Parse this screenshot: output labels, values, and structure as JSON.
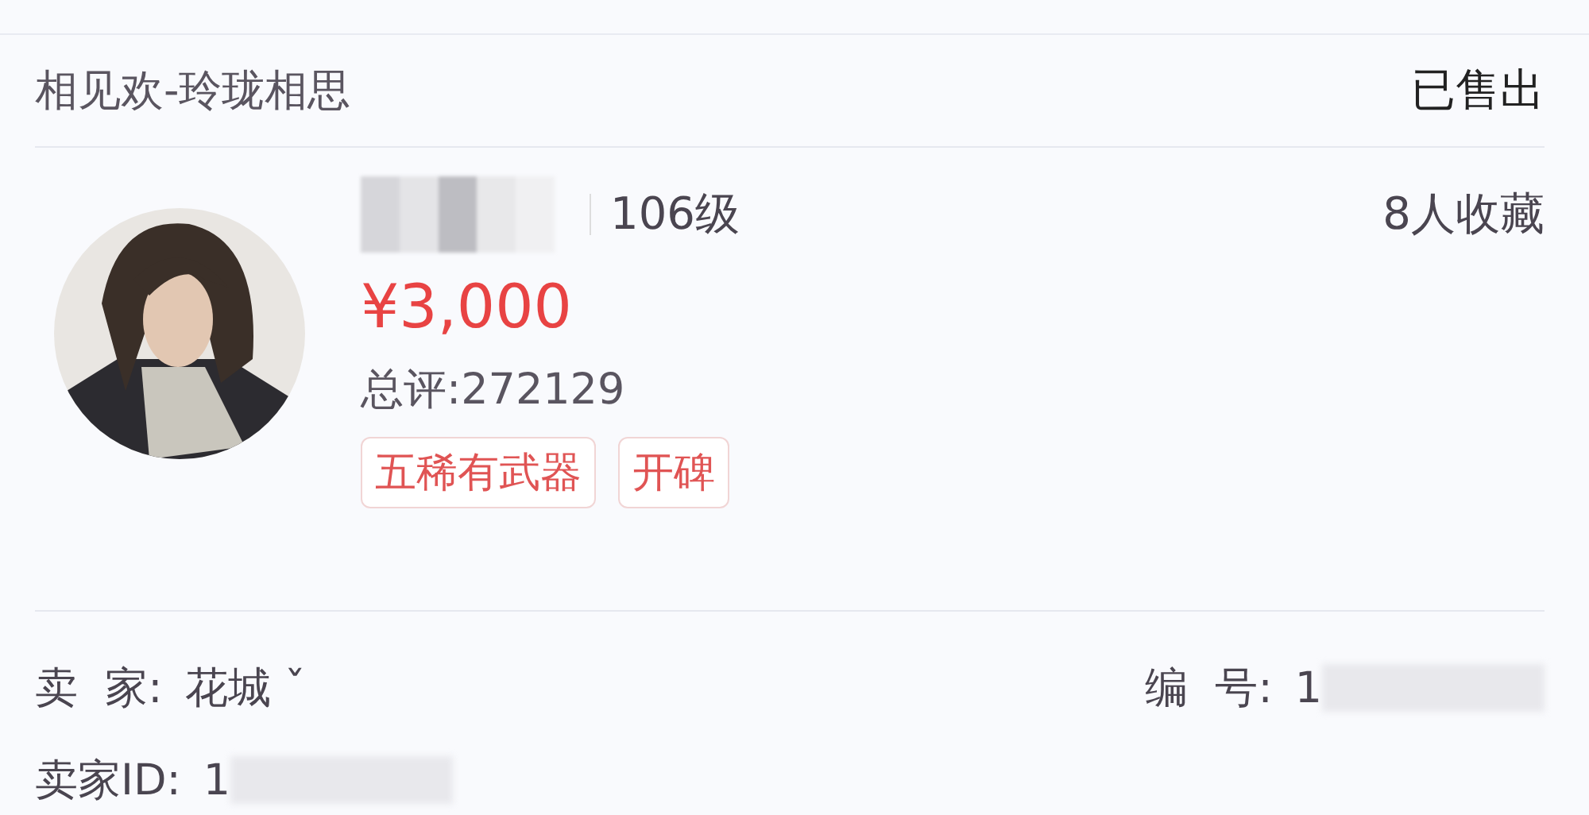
{
  "header": {
    "title": "相见欢-玲珑相思",
    "status": "已售出"
  },
  "item": {
    "avatar": {
      "kind": "picture"
    },
    "level": "106级",
    "favorites": "8人收藏",
    "price": "¥3,000",
    "rating": "总评:272129",
    "tags": [
      "五稀有武器",
      "开碑"
    ]
  },
  "details": [
    {
      "label": "卖  家:",
      "value": "花城 ˇ",
      "redacted": false
    },
    {
      "label": "编  号:",
      "value": "1",
      "redacted": true
    },
    {
      "label": "卖家ID:",
      "value": "1",
      "redacted": true
    }
  ]
}
